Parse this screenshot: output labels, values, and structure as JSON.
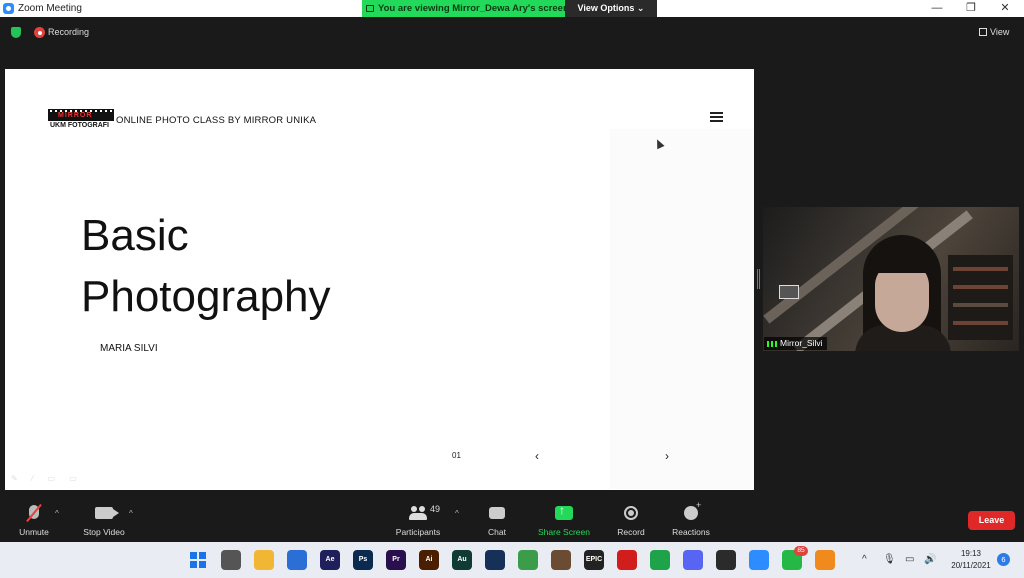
{
  "window": {
    "title": "Zoom Meeting",
    "minimize": "—",
    "restore": "❐",
    "close": "✕"
  },
  "share_banner": {
    "text": "You are viewing Mirror_Dewa Ary's screen",
    "view_options": "View Options ⌄"
  },
  "meeting_bar": {
    "recording": "Recording",
    "view": "View"
  },
  "slide": {
    "header_text": "ONLINE PHOTO CLASS BY MIRROR UNIKA",
    "logo_text": "MIRROR",
    "logo_subtitle": "UKM FOTOGRAFI",
    "title_line1": "Basic",
    "title_line2": "Photography",
    "author": "MARIA SILVI",
    "page_number": "01",
    "prev": "‹",
    "next": "›"
  },
  "video": {
    "participant_name": "Mirror_Silvi"
  },
  "toolbar": {
    "unmute": "Unmute",
    "stop_video": "Stop Video",
    "participants": "Participants",
    "participant_count": "49",
    "chat": "Chat",
    "share_screen": "Share Screen",
    "record": "Record",
    "reactions": "Reactions",
    "leave": "Leave",
    "caret": "^"
  },
  "taskbar": {
    "apps": [
      {
        "name": "windows-start",
        "label": "",
        "color": "#1a73e8"
      },
      {
        "name": "task-view",
        "label": "",
        "color": "#555555"
      },
      {
        "name": "file-explorer",
        "label": "",
        "color": "#f2b635"
      },
      {
        "name": "microsoft-store",
        "label": "",
        "color": "#2b6fd6"
      },
      {
        "name": "after-effects",
        "label": "Ae",
        "color": "#1f1f5c"
      },
      {
        "name": "photoshop",
        "label": "Ps",
        "color": "#0b2a4f"
      },
      {
        "name": "premiere",
        "label": "Pr",
        "color": "#2a0f4f"
      },
      {
        "name": "illustrator",
        "label": "Ai",
        "color": "#4a1e00"
      },
      {
        "name": "audition",
        "label": "Au",
        "color": "#0f3b34"
      },
      {
        "name": "steam",
        "label": "",
        "color": "#16305a"
      },
      {
        "name": "chrome",
        "label": "",
        "color": "#3b9d4a"
      },
      {
        "name": "game-app",
        "label": "",
        "color": "#6b4b32"
      },
      {
        "name": "epic-games",
        "label": "EPIC",
        "color": "#222222"
      },
      {
        "name": "flash-app",
        "label": "",
        "color": "#d21d1d"
      },
      {
        "name": "razer-app",
        "label": "",
        "color": "#1ea34b"
      },
      {
        "name": "discord",
        "label": "",
        "color": "#5865f2"
      },
      {
        "name": "obs",
        "label": "",
        "color": "#2b2b2b"
      },
      {
        "name": "zoom",
        "label": "",
        "color": "#2d8cff"
      },
      {
        "name": "whatsapp",
        "label": "",
        "color": "#25b847"
      },
      {
        "name": "ccleaner-app",
        "label": "",
        "color": "#f08a1c"
      }
    ],
    "whatsapp_badge": "85",
    "time": "19:13",
    "date": "20/11/2021",
    "notifications": "6",
    "tray_up": "^",
    "tray_mic": "🎙",
    "tray_monitor": "▭",
    "tray_volume": "🔊"
  }
}
